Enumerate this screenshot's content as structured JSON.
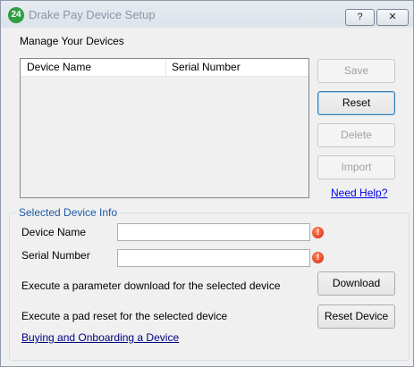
{
  "window": {
    "title": "Drake Pay Device Setup",
    "app_icon_text": "24",
    "help_button": "?",
    "close_button": "✕"
  },
  "manage_section": {
    "label": "Manage Your Devices",
    "columns": [
      "Device Name",
      "Serial Number"
    ],
    "rows": []
  },
  "side_buttons": {
    "save": "Save",
    "reset": "Reset",
    "delete": "Delete",
    "import": "Import",
    "need_help": "Need Help?"
  },
  "selected_device_info": {
    "title": "Selected Device Info",
    "device_name_label": "Device Name",
    "device_name_value": "",
    "serial_number_label": "Serial Number",
    "serial_number_value": "",
    "error_icon": "!",
    "download_text": "Execute a parameter download for the selected device",
    "download_button": "Download",
    "reset_text": "Execute a pad reset for the selected device",
    "reset_device_button": "Reset Device",
    "onboarding_link": "Buying and Onboarding a Device"
  },
  "colors": {
    "title_text": "#8a96a3",
    "group_title": "#1d5aa8",
    "link": "#0000ee",
    "error_icon": "#d4200b",
    "app_icon": "#2f9e44"
  }
}
